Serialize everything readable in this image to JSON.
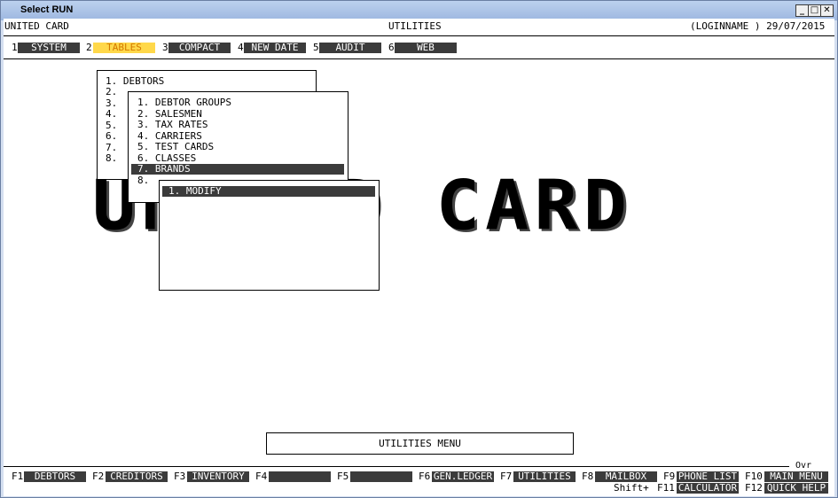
{
  "window": {
    "title": "Select RUN",
    "min_glyph": "_",
    "max_glyph": "□",
    "close_glyph": "✕"
  },
  "header": {
    "company": "UNITED CARD",
    "screen": "UTILITIES",
    "user_date": "(LOGINNAME ) 29/07/2015"
  },
  "menubar": [
    {
      "num": "1",
      "label": "SYSTEM"
    },
    {
      "num": "2",
      "label": "TABLES"
    },
    {
      "num": "3",
      "label": "COMPACT"
    },
    {
      "num": "4",
      "label": "NEW DATE"
    },
    {
      "num": "5",
      "label": "AUDIT"
    },
    {
      "num": "6",
      "label": "WEB"
    }
  ],
  "banner": "UNITED CARD",
  "menu1": {
    "items": [
      "1. DEBTORS",
      "2.",
      "3.",
      "4.",
      "5.",
      "6.",
      "7.",
      "8."
    ]
  },
  "menu2": {
    "items": [
      "1. DEBTOR GROUPS",
      "2. SALESMEN",
      "3. TAX RATES",
      "4. CARRIERS",
      "5. TEST CARDS",
      "6. CLASSES",
      "7. BRANDS",
      "8."
    ]
  },
  "menu3": {
    "items": [
      "1. MODIFY"
    ]
  },
  "status_box": "UTILITIES MENU",
  "ovr": "Ovr",
  "fkeys": [
    {
      "key": "F1",
      "label": "DEBTORS"
    },
    {
      "key": "F2",
      "label": "CREDITORS"
    },
    {
      "key": "F3",
      "label": "INVENTORY"
    },
    {
      "key": "F4",
      "label": ""
    },
    {
      "key": "F5",
      "label": ""
    },
    {
      "key": "F6",
      "label": "GEN.LEDGER"
    },
    {
      "key": "F7",
      "label": "UTILITIES"
    },
    {
      "key": "F8",
      "label": "MAILBOX"
    },
    {
      "key": "F9",
      "label": "PHONE LIST"
    },
    {
      "key": "F10",
      "label": "MAIN MENU"
    }
  ],
  "shift_row": {
    "prefix": "Shift+",
    "f11": "F11",
    "f11_label": "CALCULATOR",
    "f12": "F12",
    "f12_label": "QUICK HELP"
  }
}
